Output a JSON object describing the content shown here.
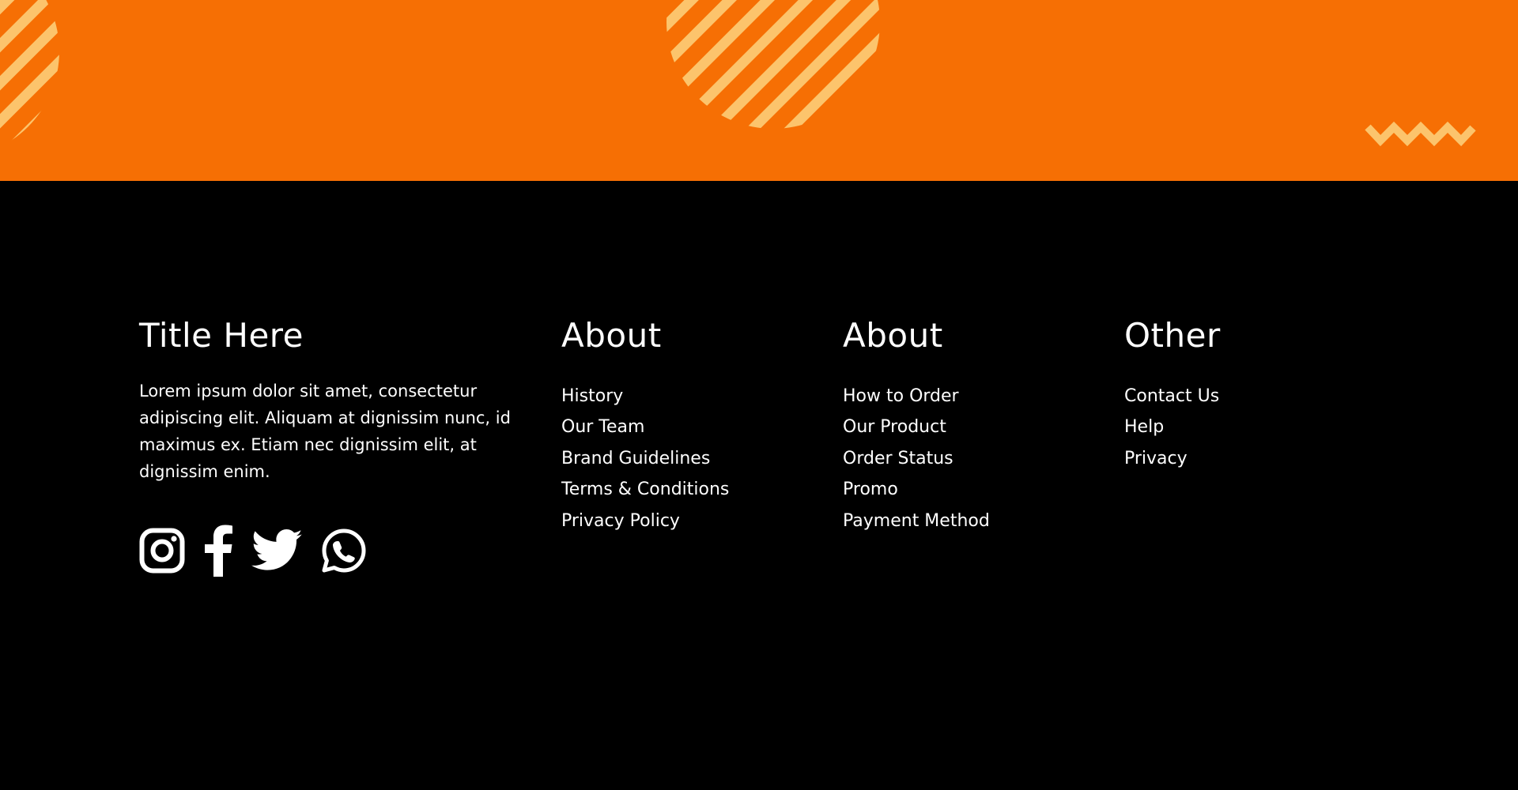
{
  "colors": {
    "banner": "#f66f04",
    "decor": "#fcc46c",
    "footer_bg": "#000000",
    "text": "#ffffff"
  },
  "brand": {
    "title": "Title Here",
    "description": "Lorem ipsum dolor sit amet, consectetur adipiscing elit. Aliquam at dignissim nunc, id maximus ex. Etiam nec dignissim elit, at dignissim enim.",
    "social": [
      {
        "icon": "instagram-icon"
      },
      {
        "icon": "facebook-icon"
      },
      {
        "icon": "twitter-icon"
      },
      {
        "icon": "whatsapp-icon"
      }
    ]
  },
  "columns": [
    {
      "title": "About",
      "links": [
        "History",
        "Our Team",
        "Brand Guidelines",
        "Terms & Conditions",
        "Privacy Policy"
      ]
    },
    {
      "title": "About",
      "links": [
        "How to Order",
        "Our Product",
        "Order Status",
        "Promo",
        "Payment Method"
      ]
    },
    {
      "title": "Other",
      "links": [
        "Contact Us",
        "Help",
        "Privacy"
      ]
    }
  ]
}
